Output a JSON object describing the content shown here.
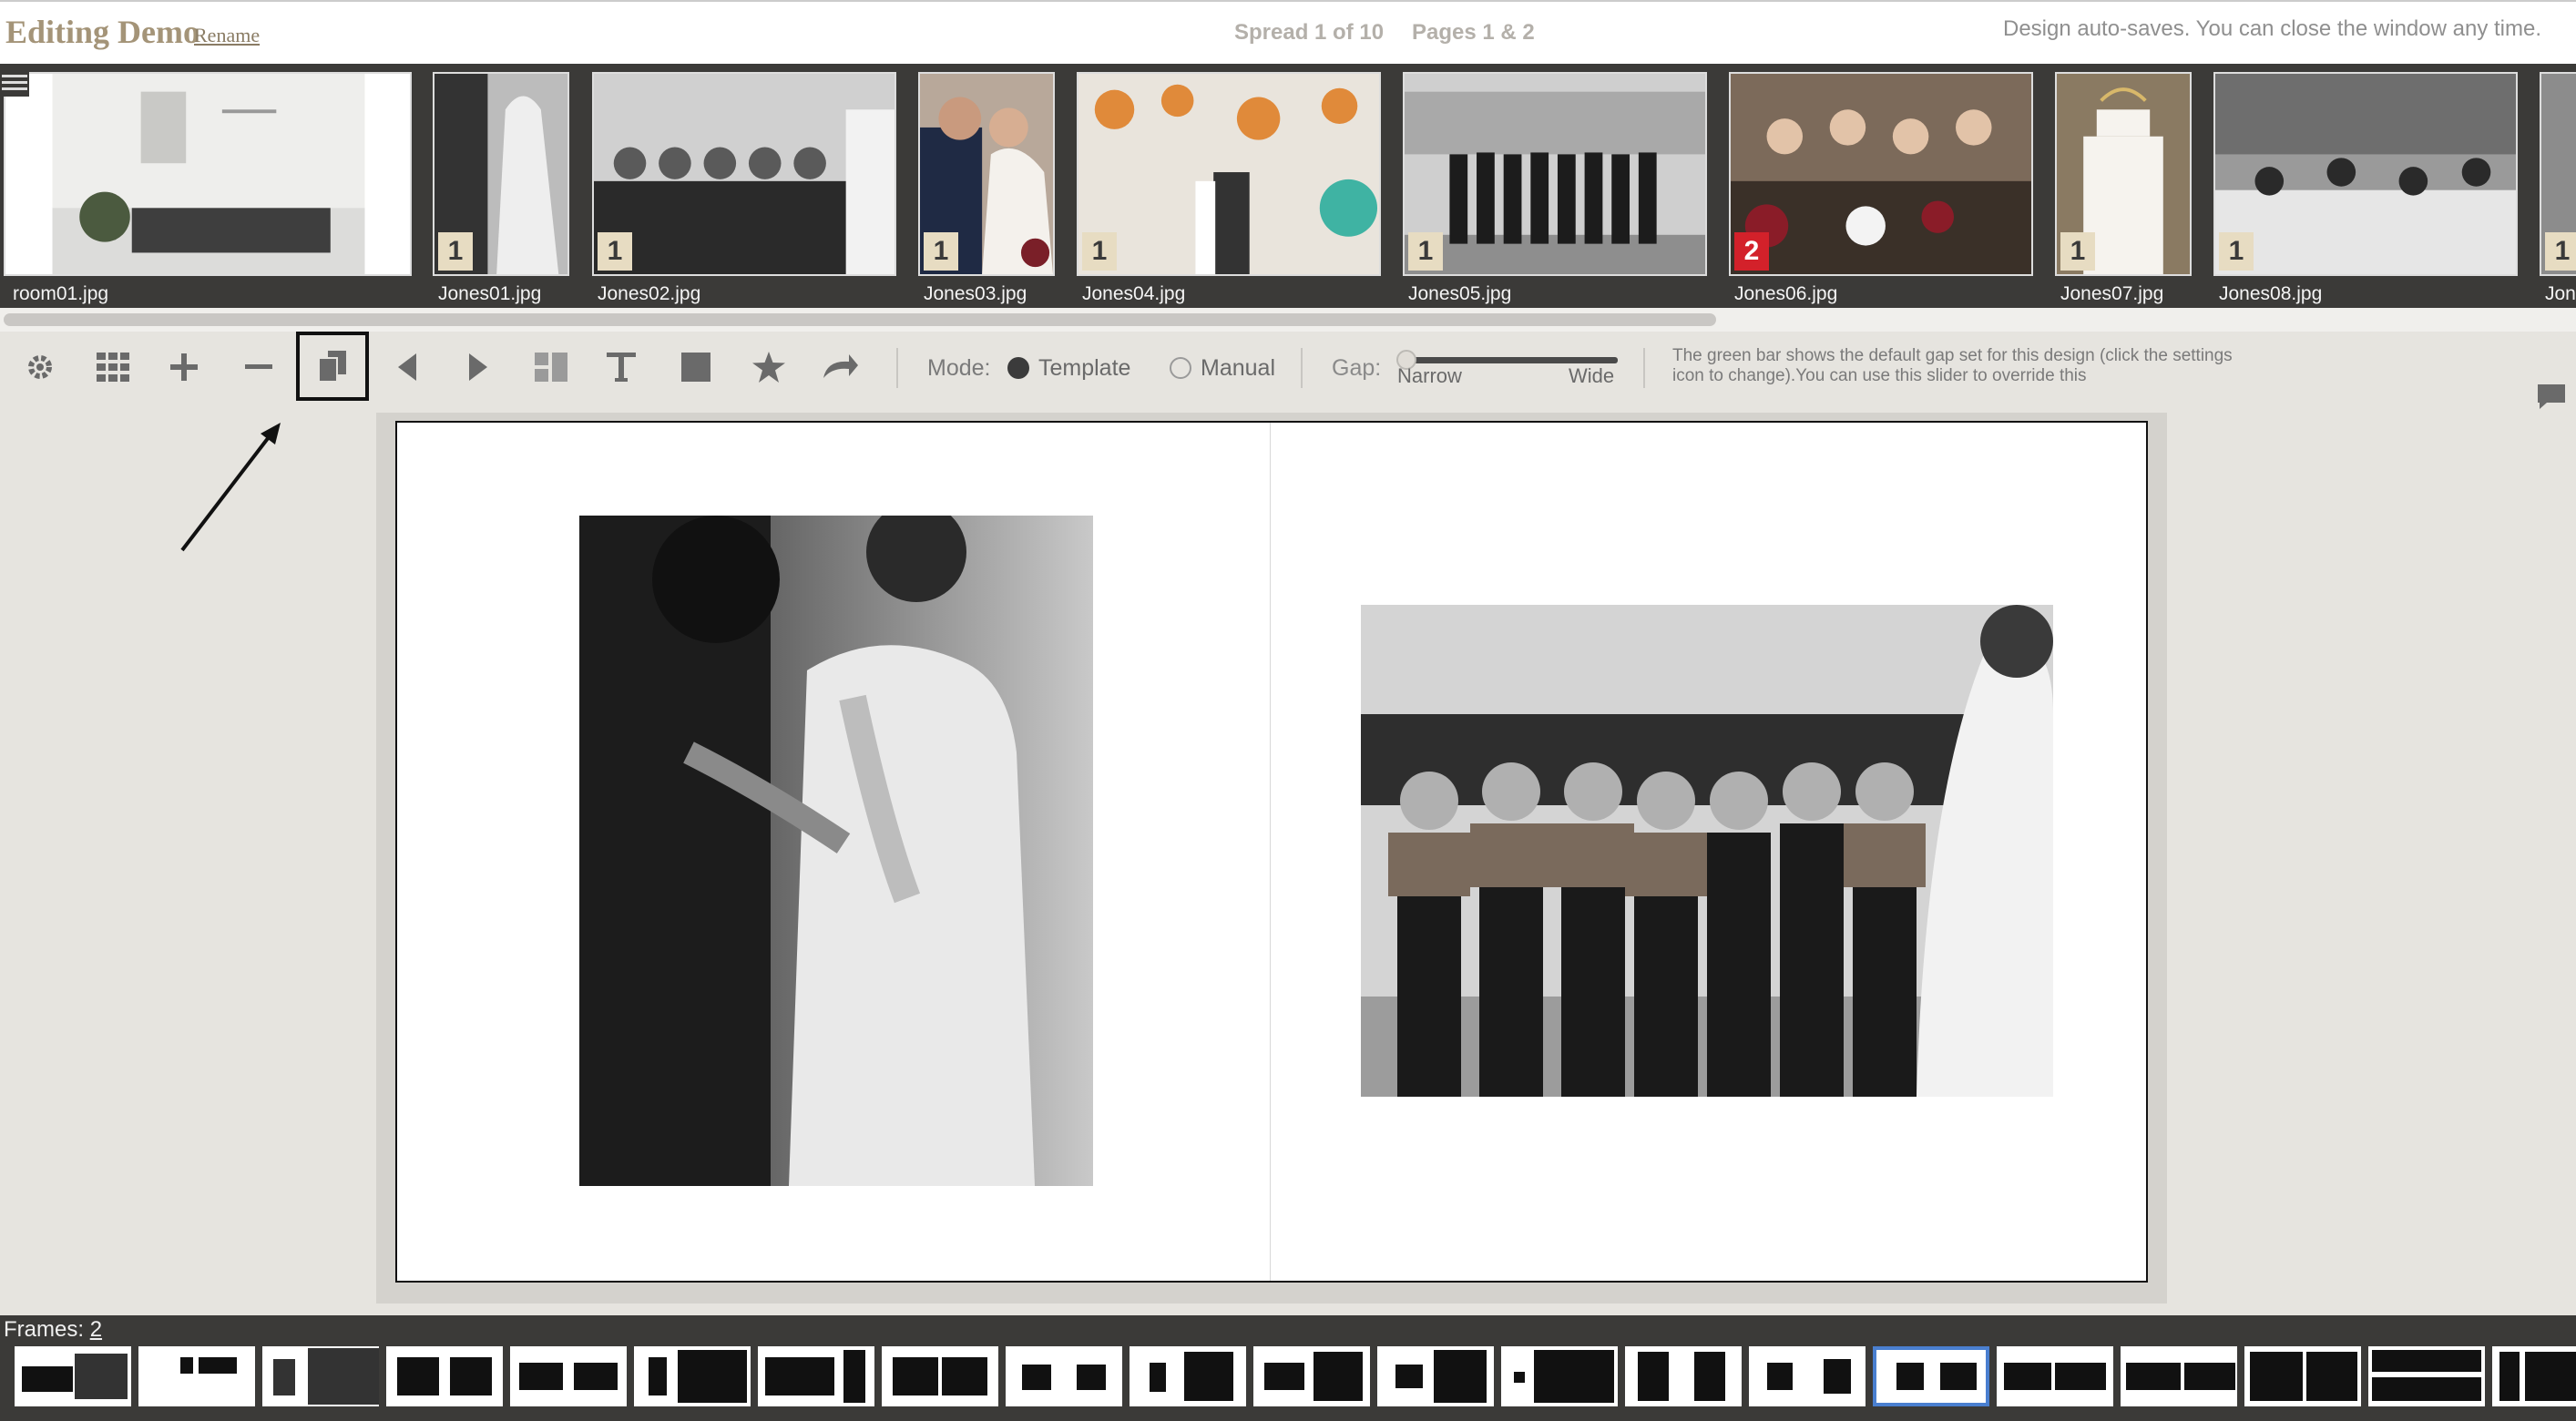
{
  "header": {
    "title": "Editing Demo",
    "rename_label": "Rename",
    "spread_label": "Spread 1 of 10",
    "pages_label": "Pages 1 & 2",
    "autosave_text": "Design auto-saves. You can close the window any time."
  },
  "photo_strip": {
    "items": [
      {
        "name": "room01.jpg",
        "badge": ""
      },
      {
        "name": "Jones01.jpg",
        "badge": "1"
      },
      {
        "name": "Jones02.jpg",
        "badge": "1"
      },
      {
        "name": "Jones03.jpg",
        "badge": "1"
      },
      {
        "name": "Jones04.jpg",
        "badge": "1"
      },
      {
        "name": "Jones05.jpg",
        "badge": "1"
      },
      {
        "name": "Jones06.jpg",
        "badge": "2"
      },
      {
        "name": "Jones07.jpg",
        "badge": "1"
      },
      {
        "name": "Jones08.jpg",
        "badge": "1"
      },
      {
        "name": "Jon",
        "badge": "1"
      }
    ]
  },
  "toolbar": {
    "icons": [
      "gear-icon",
      "grid-icon",
      "plus-icon",
      "minus-icon",
      "copy-icon",
      "arrow-left-icon",
      "arrow-right-icon",
      "layout-icon",
      "text-icon",
      "square-icon",
      "star-icon",
      "undo-icon"
    ],
    "mode_label": "Mode:",
    "mode_template": "Template",
    "mode_manual": "Manual",
    "mode_selected": "Template",
    "gap_label": "Gap:",
    "gap_narrow": "Narrow",
    "gap_wide": "Wide",
    "gap_help": "The green bar shows the default gap set for this design (click the settings icon to change).You can use this slider to override this"
  },
  "bottom": {
    "frames_label": "Frames:",
    "frames_value": "2",
    "selected_layout_index": 15
  },
  "colors": {
    "badge": "#e7dcc2",
    "badge_alert": "#d3212a",
    "selection": "#4a7fd0",
    "title": "#a49478"
  }
}
